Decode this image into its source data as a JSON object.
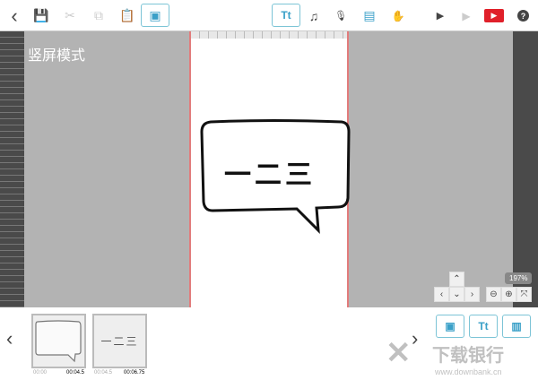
{
  "toolbar": {
    "items": [
      {
        "name": "back",
        "glyph": "‹"
      },
      {
        "name": "save",
        "glyph": "💾"
      },
      {
        "name": "cut",
        "glyph": "✂"
      },
      {
        "name": "copy",
        "glyph": "⧉"
      },
      {
        "name": "paste",
        "glyph": "📋"
      },
      {
        "name": "image",
        "glyph": "▣"
      }
    ],
    "text_label": "Tt",
    "music": "♫",
    "mic": "🎙",
    "doc": "▤",
    "hand": "✋",
    "play_from": "▶",
    "play": "▶",
    "record": "▶",
    "help": "?"
  },
  "canvas": {
    "mode_label": "竖屏模式",
    "bubble_text": "一二三",
    "zoom": "197%"
  },
  "nav": {
    "up": "⌃",
    "left": "‹",
    "down": "⌄",
    "right": "›",
    "zoom_out": "⊖",
    "zoom_in": "⊕",
    "fit": "⤧"
  },
  "timeline": {
    "prev": "‹",
    "next": "›",
    "frames": [
      {
        "start": "00:00",
        "end": "00:04.5",
        "content": ""
      },
      {
        "start": "00:04.5",
        "end": "00:06.75",
        "content": "一二三"
      }
    ]
  },
  "add_buttons": {
    "image": "▣",
    "text": "Tt",
    "chart": "▥"
  },
  "watermark": {
    "title": "下载银行",
    "url": "www.downbank.cn"
  }
}
